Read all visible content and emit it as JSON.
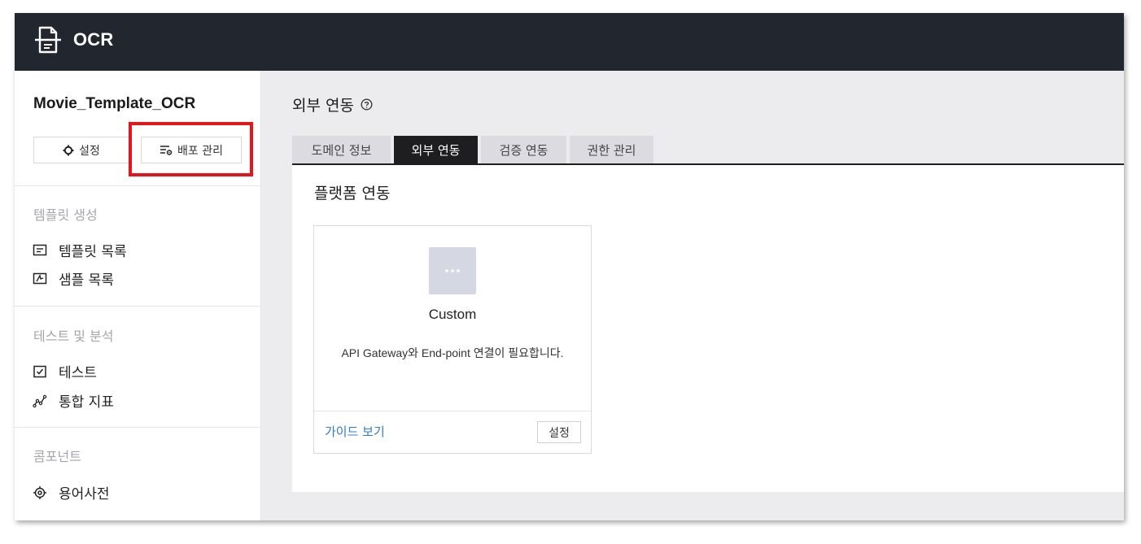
{
  "app": {
    "title": "OCR",
    "logo_icon": "document-icon"
  },
  "sidebar": {
    "project_name": "Movie_Template_OCR",
    "settings_button": {
      "label": "설정",
      "icon": "gear-icon"
    },
    "deploy_button": {
      "label": "배포 관리",
      "icon": "deploy-settings-icon"
    },
    "sections": [
      {
        "title": "템플릿 생성",
        "items": [
          {
            "label": "템플릿 목록",
            "icon": "list-icon"
          },
          {
            "label": "샘플 목록",
            "icon": "sample-image-icon"
          }
        ]
      },
      {
        "title": "테스트 및 분석",
        "items": [
          {
            "label": "테스트",
            "icon": "checkbox-icon"
          },
          {
            "label": "통합 지표",
            "icon": "line-graph-icon"
          }
        ]
      },
      {
        "title": "콤포넌트",
        "items": [
          {
            "label": "용어사전",
            "icon": "target-icon"
          }
        ]
      }
    ]
  },
  "main": {
    "title": "외부 연동",
    "help_icon": "question-circle-icon",
    "tabs": [
      {
        "label": "도메인 정보",
        "active": false
      },
      {
        "label": "외부 연동",
        "active": true
      },
      {
        "label": "검증 연동",
        "active": false
      },
      {
        "label": "권한 관리",
        "active": false
      }
    ],
    "panel_title": "플랫폼 연동",
    "card": {
      "icon": "more-dots-icon",
      "name": "Custom",
      "description": "API Gateway와 End-point 연결이 필요합니다.",
      "guide_link": "가이드 보기",
      "settings_button": "설정"
    }
  },
  "colors": {
    "topbar": "#22262e",
    "highlight": "#e8141b",
    "active_tab": "#1e1e21",
    "link": "#2f7bd6"
  }
}
